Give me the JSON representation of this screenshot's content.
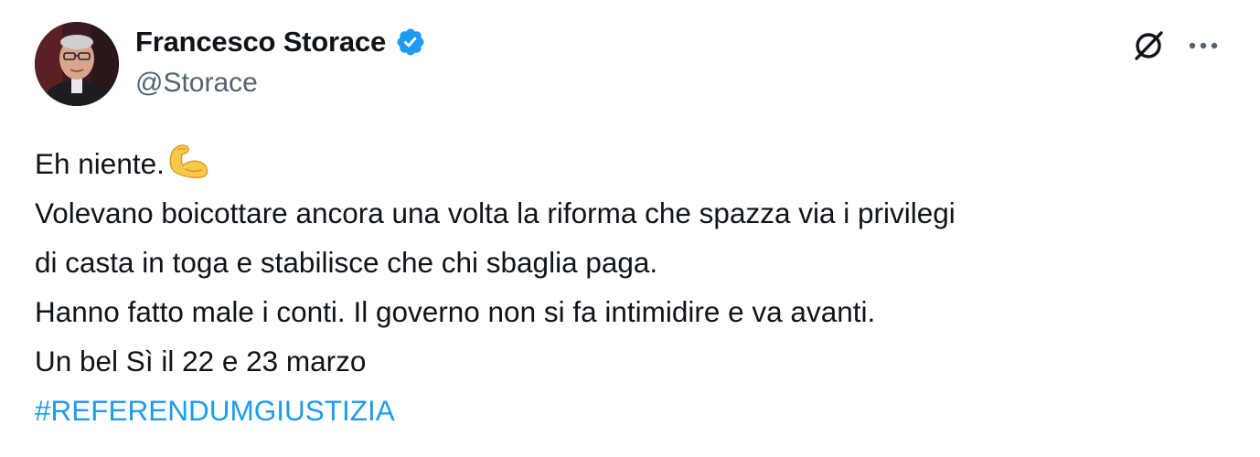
{
  "author": {
    "display_name": "Francesco Storace",
    "handle": "@Storace",
    "verified": true,
    "avatar_icon": "user-avatar-photo"
  },
  "actions": {
    "grok_icon": "grok-icon",
    "more_icon": "more-dots-icon"
  },
  "tweet": {
    "line1_text": "Eh niente.",
    "line1_emoji": "flexed-biceps-emoji",
    "line2": "Volevano boicottare ancora una volta la riforma che spazza via i privilegi",
    "line3": "di casta in toga e stabilisce che chi sbaglia paga.",
    "line4": "Hanno fatto male i conti. Il governo non si fa intimidire e va avanti.",
    "line5": "Un bel Sì il 22 e 23 marzo",
    "hashtag": "#REFERENDUMGIUSTIZIA"
  },
  "colors": {
    "text": "#0f1419",
    "secondary": "#536471",
    "link": "#1d9bf0",
    "verified_badge": "#1d9bf0"
  }
}
